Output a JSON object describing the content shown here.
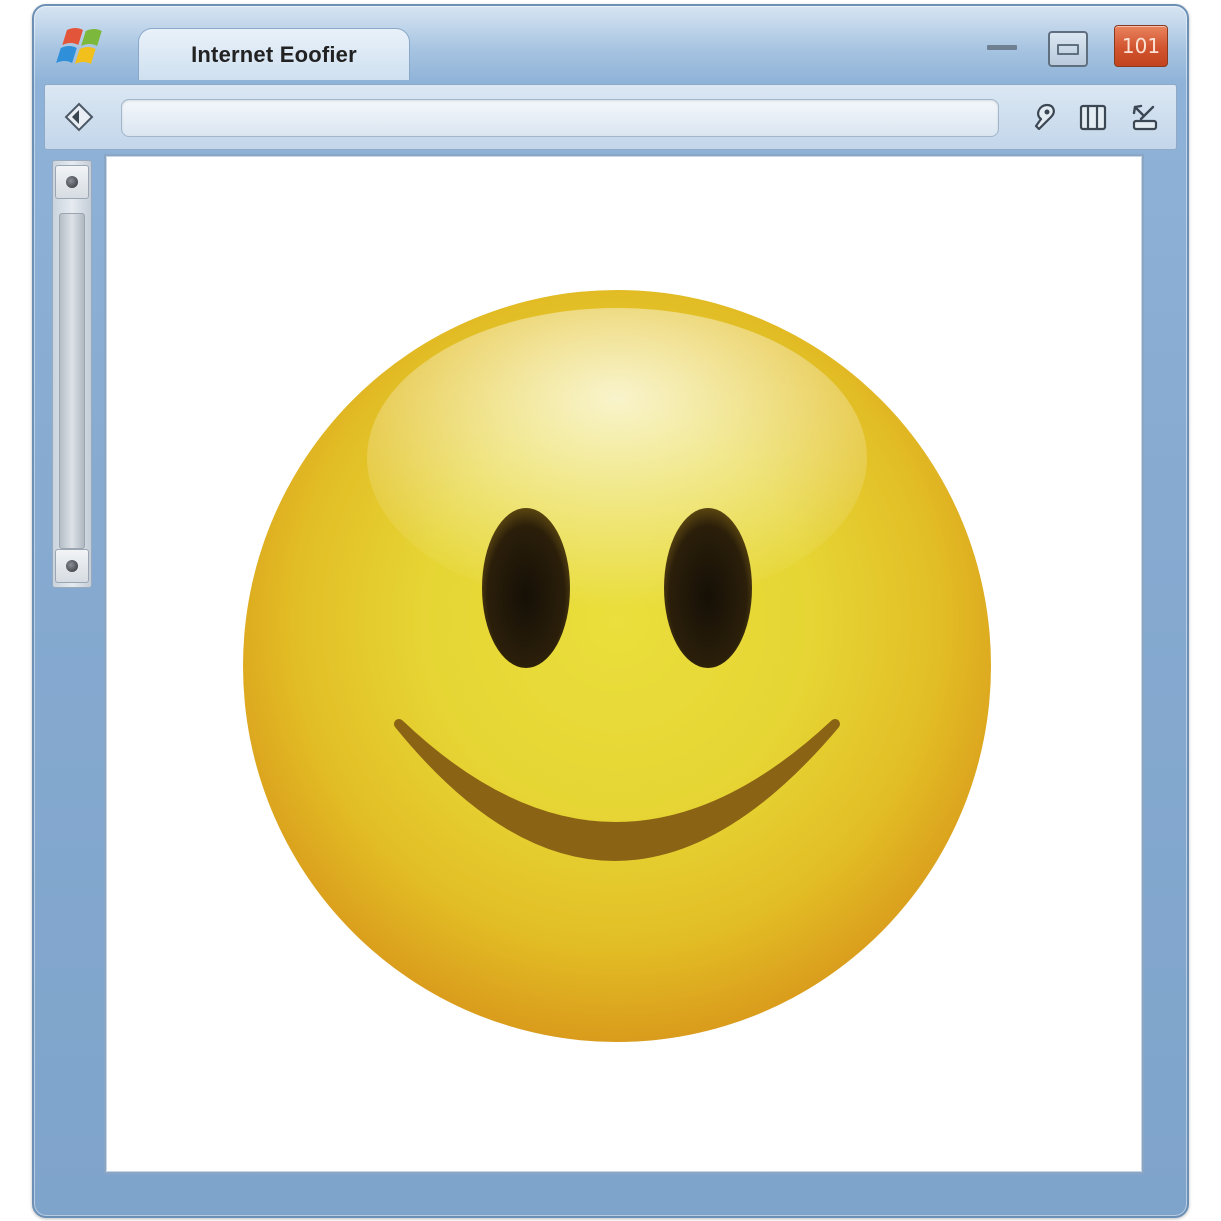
{
  "window": {
    "tab_title": "Internet Eoofier",
    "close_glyph": "101"
  },
  "toolbar": {
    "address_value": "",
    "icons": [
      "pin-icon",
      "bookmarks-icon",
      "tools-icon"
    ]
  },
  "content": {
    "image": "smiley-face-emoji"
  },
  "colors": {
    "frame": "#86aad0",
    "close_button": "#d1542f",
    "smiley_yellow": "#e8d435",
    "smiley_edge": "#d99a12"
  }
}
